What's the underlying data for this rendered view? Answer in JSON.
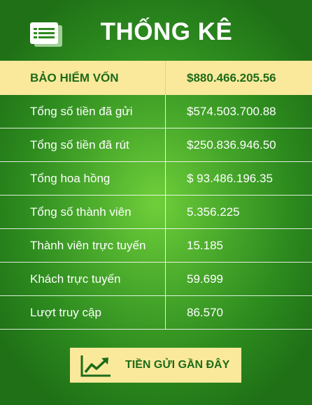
{
  "header": {
    "title": "THỐNG KÊ",
    "icon": "list-icon"
  },
  "stats": {
    "head": {
      "label": "BẢO HIỂM VỐN",
      "value": "$880.466.205.56"
    },
    "rows": [
      {
        "label": "Tổng số tiền đã gửi",
        "value": "$574.503.700.88"
      },
      {
        "label": "Tổng số tiền đã rút",
        "value": "$250.836.946.50"
      },
      {
        "label": "Tổng hoa hồng",
        "value": "$ 93.486.196.35"
      },
      {
        "label": "Tổng số thành viên",
        "value": "5.356.225"
      },
      {
        "label": "Thành viên trực tuyến",
        "value": "15.185"
      },
      {
        "label": "Khách trực tuyến",
        "value": "59.699"
      },
      {
        "label": "Lượt truy cập",
        "value": "86.570"
      }
    ]
  },
  "recent_button": {
    "label": "TIỀN GỬI GẦN ĐÂY",
    "icon": "trending-up-chart-icon"
  },
  "colors": {
    "accent_yellow": "#fbe99b",
    "text_green": "#1d6b1a",
    "background_green": "#46a62a"
  }
}
